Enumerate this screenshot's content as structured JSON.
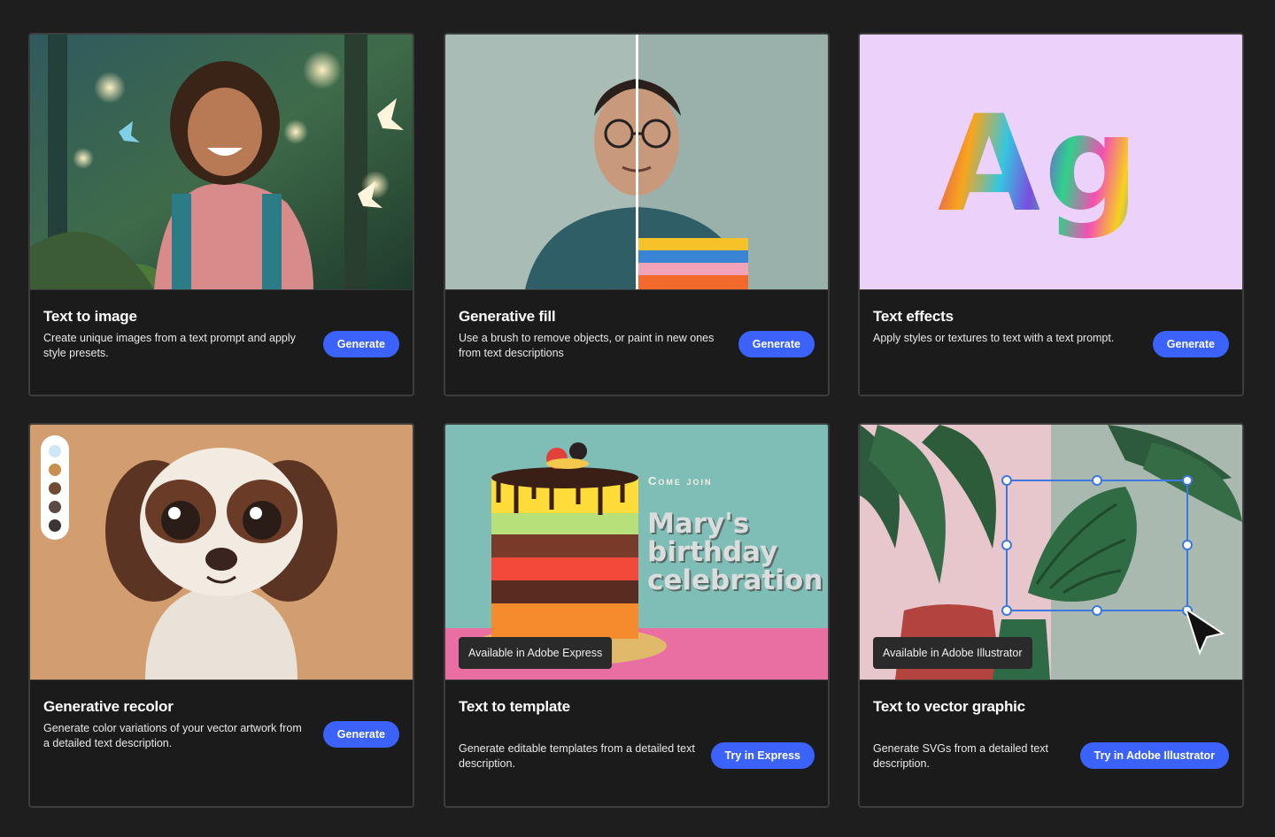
{
  "cards": [
    {
      "title": "Text to image",
      "description": "Create unique images from a text prompt and apply style presets.",
      "button": "Generate"
    },
    {
      "title": "Generative fill",
      "description": "Use a brush to remove objects, or paint in new ones from text descriptions",
      "button": "Generate"
    },
    {
      "title": "Text effects",
      "description": "Apply styles or textures to text with a text prompt.",
      "button": "Generate",
      "image_text": "Ag"
    },
    {
      "title": "Generative recolor",
      "description": "Generate color variations of your vector artwork from a detailed text description.",
      "button": "Generate",
      "swatches": [
        "#cfe6f7",
        "#c98f4e",
        "#6f4b33",
        "#5a4a41",
        "#3b3634"
      ]
    },
    {
      "title": "Text to template",
      "description": "Generate editable templates from a detailed text description.",
      "button": "Try in Express",
      "badge": "Available in Adobe Express",
      "overlay_small": "Come join",
      "overlay_big": "Mary's birthday celebration"
    },
    {
      "title": "Text to vector graphic",
      "description": "Generate SVGs from a detailed text description.",
      "button": "Try in Adobe Illustrator",
      "badge": "Available in Adobe Illustrator"
    }
  ],
  "colors": {
    "background": "#1e1e1e",
    "card_border": "#3d3d3d",
    "button": "#3b63fb"
  }
}
